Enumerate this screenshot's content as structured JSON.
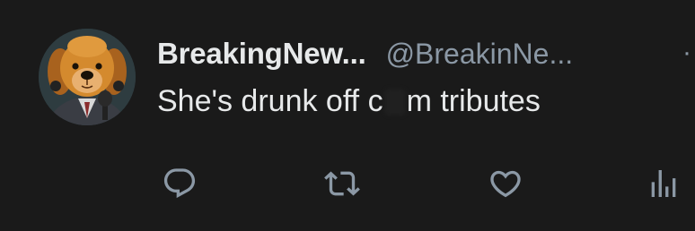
{
  "tweet": {
    "display_name": "BreakingNew...",
    "handle": "@BreakinNe...",
    "separator": "·",
    "text_before": "She's drunk off c",
    "text_after": "m tributes"
  },
  "actions": {
    "reply_icon": "reply-icon",
    "retweet_icon": "retweet-icon",
    "like_icon": "heart-icon",
    "views_icon": "views-icon"
  },
  "colors": {
    "background": "#1a1a1a",
    "primary_text": "#e7e9ea",
    "secondary_text": "#8b98a5"
  }
}
